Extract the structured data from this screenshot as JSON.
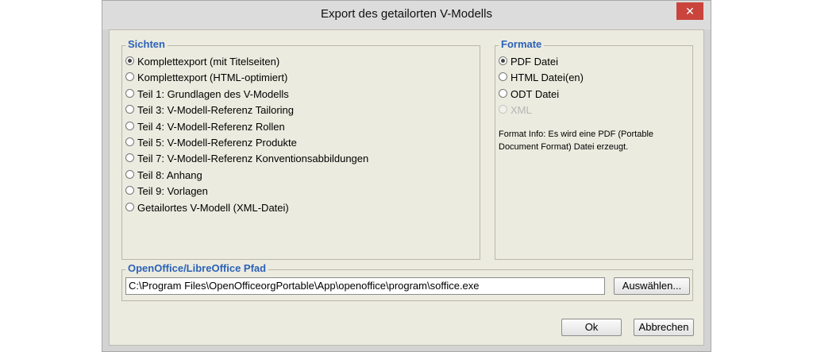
{
  "window": {
    "title": "Export des getailorten V-Modells",
    "close_icon": "✕"
  },
  "sichten": {
    "legend": "Sichten",
    "options": [
      {
        "label": "Komplettexport (mit Titelseiten)",
        "checked": true
      },
      {
        "label": "Komplettexport (HTML-optimiert)",
        "checked": false
      },
      {
        "label": "Teil 1: Grundlagen des V-Modells",
        "checked": false
      },
      {
        "label": "Teil 3: V-Modell-Referenz Tailoring",
        "checked": false
      },
      {
        "label": "Teil 4: V-Modell-Referenz Rollen",
        "checked": false
      },
      {
        "label": "Teil 5: V-Modell-Referenz Produkte",
        "checked": false
      },
      {
        "label": "Teil 7: V-Modell-Referenz Konventionsabbildungen",
        "checked": false
      },
      {
        "label": "Teil 8: Anhang",
        "checked": false
      },
      {
        "label": "Teil 9: Vorlagen",
        "checked": false
      },
      {
        "label": "Getailortes V-Modell (XML-Datei)",
        "checked": false
      }
    ]
  },
  "formate": {
    "legend": "Formate",
    "options": [
      {
        "label": "PDF Datei",
        "checked": true,
        "disabled": false
      },
      {
        "label": "HTML Datei(en)",
        "checked": false,
        "disabled": false
      },
      {
        "label": "ODT Datei",
        "checked": false,
        "disabled": false
      },
      {
        "label": "XML",
        "checked": false,
        "disabled": true
      }
    ],
    "info": "Format Info: Es wird eine PDF (Portable Document Format) Datei erzeugt."
  },
  "pfad": {
    "legend": "OpenOffice/LibreOffice Pfad",
    "value": "C:\\Program Files\\OpenOfficeorgPortable\\App\\openoffice\\program\\soffice.exe",
    "browse_label": "Auswählen..."
  },
  "footer": {
    "ok_label": "Ok",
    "cancel_label": "Abbrechen"
  },
  "colors": {
    "legend": "#2c62b8",
    "close": "#c9443c",
    "panel": "#ecebdf"
  }
}
